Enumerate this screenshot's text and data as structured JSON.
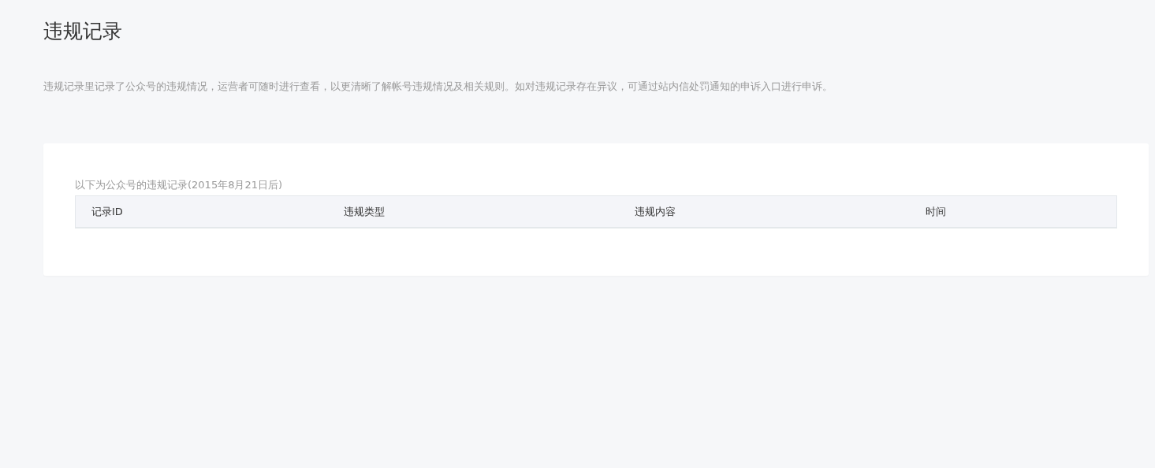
{
  "page_title": "违规记录",
  "description": "违规记录里记录了公众号的违规情况，运营者可随时进行查看，以更清晰了解帐号违规情况及相关规则。如对违规记录存在异议，可通过站内信处罚通知的申诉入口进行申诉。",
  "records": {
    "caption": "以下为公众号的违规记录(2015年8月21日后)",
    "table": {
      "columns": [
        "记录ID",
        "违规类型",
        "违规内容",
        "时间"
      ]
    }
  }
}
